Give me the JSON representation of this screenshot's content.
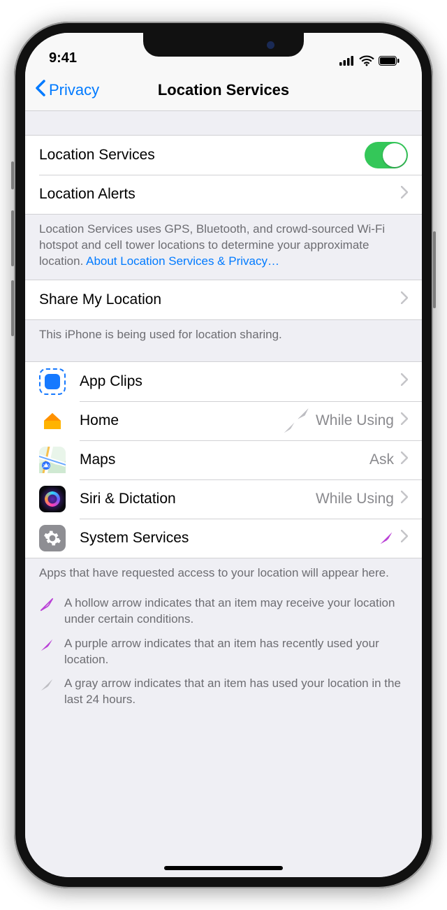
{
  "status": {
    "time": "9:41"
  },
  "nav": {
    "back": "Privacy",
    "title": "Location Services"
  },
  "rows": {
    "locationServices": "Location Services",
    "locationAlerts": "Location Alerts",
    "shareMyLocation": "Share My Location"
  },
  "footers": {
    "main": "Location Services uses GPS, Bluetooth, and crowd-sourced Wi-Fi hotspot and cell tower locations to determine your approximate location. ",
    "mainLink": "About Location Services & Privacy…",
    "share": "This iPhone is being used for location sharing.",
    "appsHeader": "Apps that have requested access to your location will appear here."
  },
  "apps": [
    {
      "name": "App Clips",
      "value": "",
      "indicator": ""
    },
    {
      "name": "Home",
      "value": "While Using",
      "indicator": "gray"
    },
    {
      "name": "Maps",
      "value": "Ask",
      "indicator": ""
    },
    {
      "name": "Siri & Dictation",
      "value": "While Using",
      "indicator": ""
    },
    {
      "name": "System Services",
      "value": "",
      "indicator": "purple"
    }
  ],
  "legend": {
    "hollow": "A hollow arrow indicates that an item may receive your location under certain conditions.",
    "purple": "A purple arrow indicates that an item has recently used your location.",
    "gray": "A gray arrow indicates that an item has used your location in the last 24 hours."
  }
}
